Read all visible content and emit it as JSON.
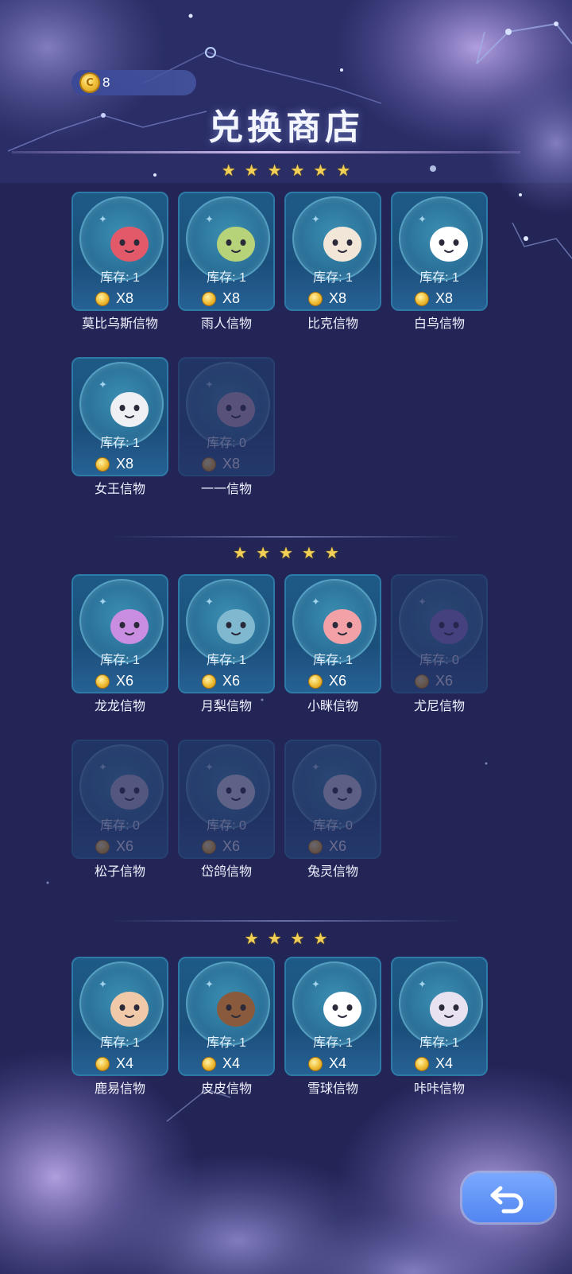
{
  "header": {
    "coin_balance": "8",
    "coin_icon": "coin-icon",
    "title": "兑换商店"
  },
  "sections": [
    {
      "stars": 6,
      "items": [
        {
          "name": "莫比乌斯信物",
          "stock": "库存: 1",
          "price": "X8",
          "available": true,
          "icon": "pink-rabbit-icon",
          "color": "#e25a6a"
        },
        {
          "name": "雨人信物",
          "stock": "库存: 1",
          "price": "X8",
          "available": true,
          "icon": "green-hood-icon",
          "color": "#b6d37a"
        },
        {
          "name": "比克信物",
          "stock": "库存: 1",
          "price": "X8",
          "available": true,
          "icon": "blonde-girl-icon",
          "color": "#f1e6d8"
        },
        {
          "name": "白鸟信物",
          "stock": "库存: 1",
          "price": "X8",
          "available": true,
          "icon": "white-ghost-icon",
          "color": "#ffffff"
        },
        {
          "name": "女王信物",
          "stock": "库存: 1",
          "price": "X8",
          "available": true,
          "icon": "white-queen-icon",
          "color": "#eef0f4"
        },
        {
          "name": "一一信物",
          "stock": "库存: 0",
          "price": "X8",
          "available": false,
          "icon": "sleeping-bird-icon",
          "color": "#c9b0c8"
        }
      ]
    },
    {
      "stars": 5,
      "items": [
        {
          "name": "龙龙信物",
          "stock": "库存: 1",
          "price": "X6",
          "available": true,
          "icon": "purple-dragon-icon",
          "color": "#c98ee0"
        },
        {
          "name": "月梨信物",
          "stock": "库存: 1",
          "price": "X6",
          "available": true,
          "icon": "blue-hair-icon",
          "color": "#7fb8cf"
        },
        {
          "name": "小眯信物",
          "stock": "库存: 1",
          "price": "X6",
          "available": true,
          "icon": "pink-lizard-icon",
          "color": "#f2a2a7"
        },
        {
          "name": "尤尼信物",
          "stock": "库存: 0",
          "price": "X6",
          "available": false,
          "icon": "unicorn-icon",
          "color": "#8c7ad0"
        },
        {
          "name": "松子信物",
          "stock": "库存: 0",
          "price": "X6",
          "available": false,
          "icon": "grey-cat-icon",
          "color": "#b9c2d6"
        },
        {
          "name": "岱鸽信物",
          "stock": "库存: 0",
          "price": "X6",
          "available": false,
          "icon": "pigeon-icon",
          "color": "#dfe4ec"
        },
        {
          "name": "兔灵信物",
          "stock": "库存: 0",
          "price": "X6",
          "available": false,
          "icon": "party-bunny-icon",
          "color": "#d7dce4"
        }
      ]
    },
    {
      "stars": 4,
      "items": [
        {
          "name": "鹿易信物",
          "stock": "库存: 1",
          "price": "X4",
          "available": true,
          "icon": "deer-icon",
          "color": "#f0c9a8"
        },
        {
          "name": "皮皮信物",
          "stock": "库存: 1",
          "price": "X4",
          "available": true,
          "icon": "cow-icon",
          "color": "#8a5a3c"
        },
        {
          "name": "雪球信物",
          "stock": "库存: 1",
          "price": "X4",
          "available": true,
          "icon": "snowball-icon",
          "color": "#ffffff"
        },
        {
          "name": "咔咔信物",
          "stock": "库存: 1",
          "price": "X4",
          "available": true,
          "icon": "goggles-creature-icon",
          "color": "#e8e2f0"
        }
      ]
    }
  ],
  "footer": {
    "back_icon": "back-arrow-icon"
  }
}
